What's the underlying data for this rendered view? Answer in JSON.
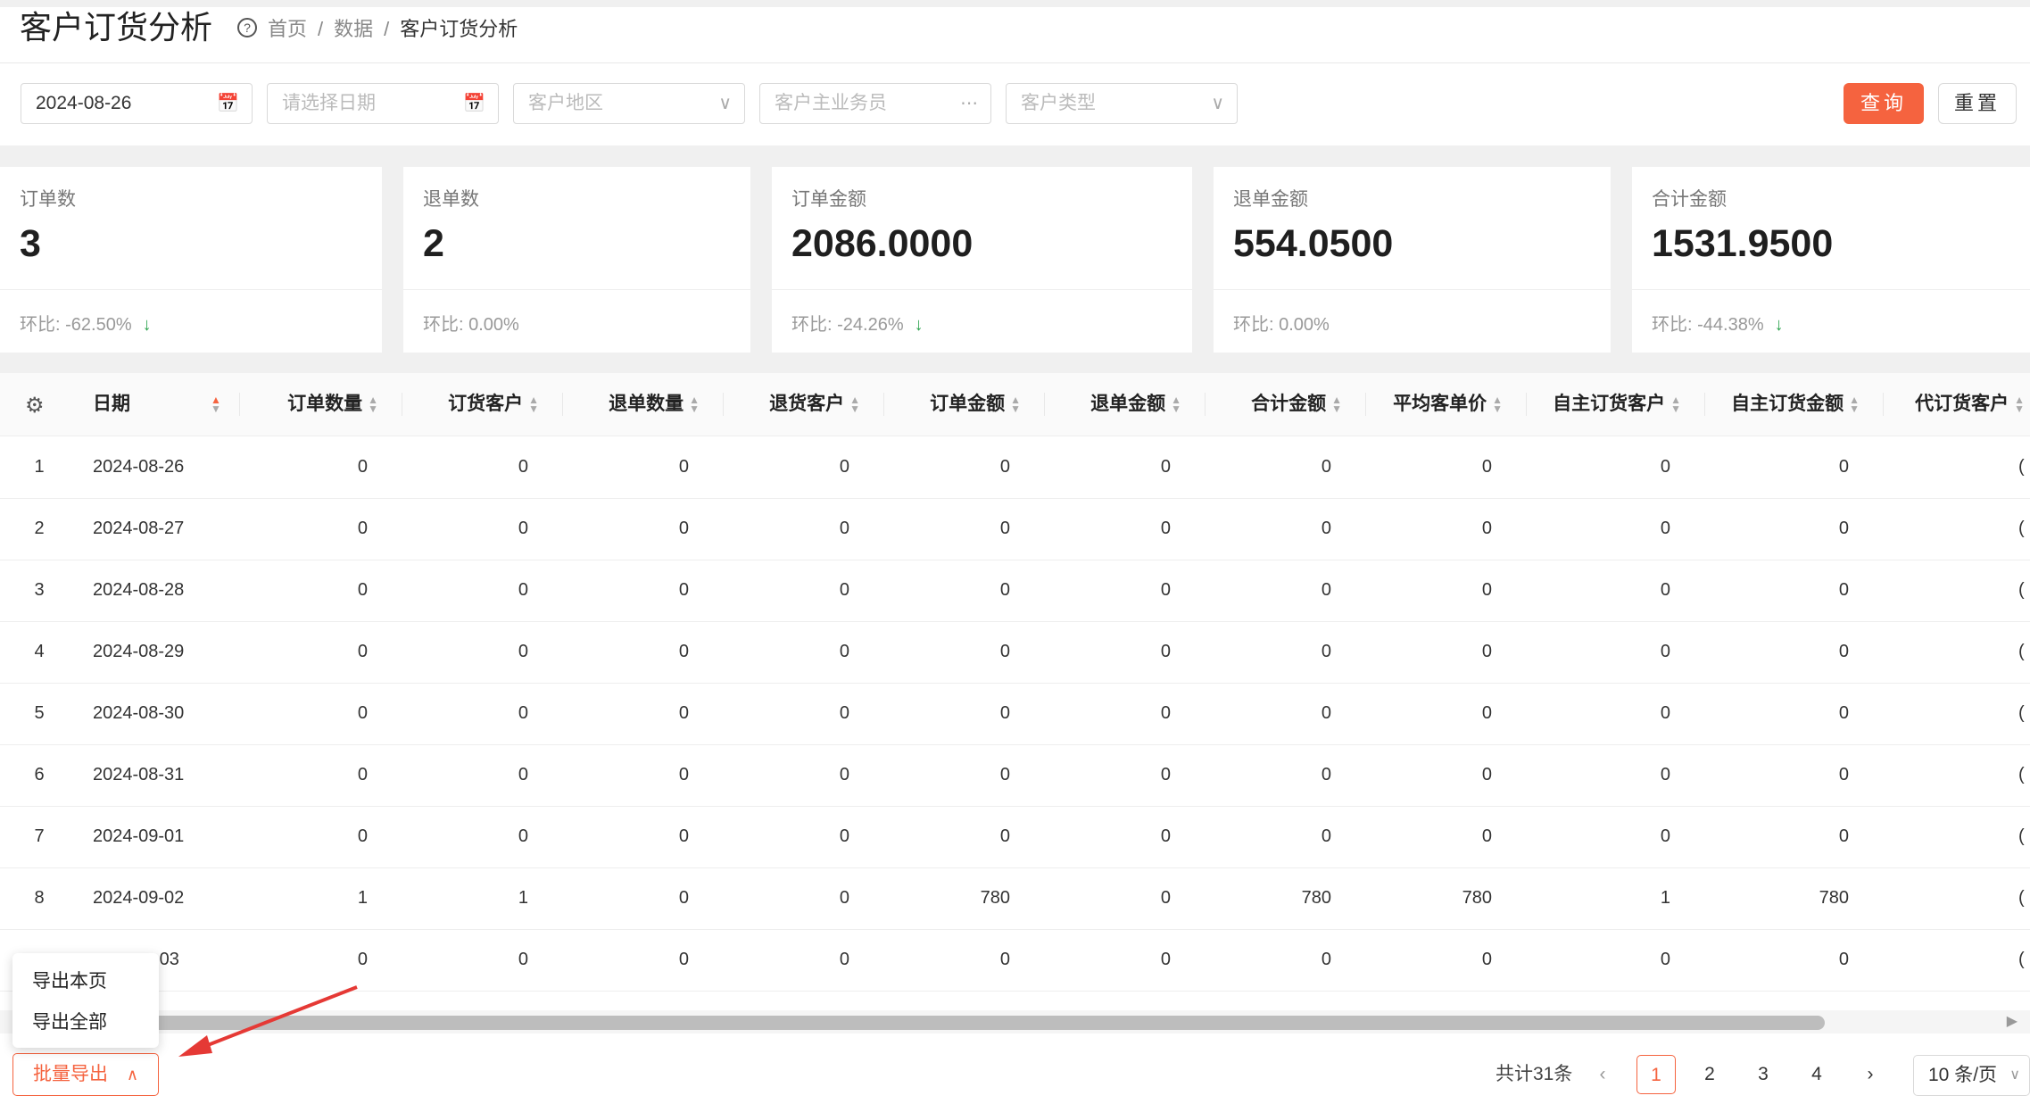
{
  "header": {
    "title": "客户订货分析",
    "breadcrumbs": [
      "首页",
      "数据",
      "客户订货分析"
    ]
  },
  "filters": {
    "start_date": "2024-08-26",
    "end_date_placeholder": "请选择日期",
    "region_placeholder": "客户地区",
    "salesman_placeholder": "客户主业务员",
    "type_placeholder": "客户类型",
    "query_label": "查询",
    "reset_label": "重置"
  },
  "cards": [
    {
      "label": "订单数",
      "value": "3",
      "ratio_label": "环比:",
      "ratio": "-62.50%",
      "down": true
    },
    {
      "label": "退单数",
      "value": "2",
      "ratio_label": "环比:",
      "ratio": "0.00%",
      "down": false
    },
    {
      "label": "订单金额",
      "value": "2086.0000",
      "ratio_label": "环比:",
      "ratio": "-24.26%",
      "down": true
    },
    {
      "label": "退单金额",
      "value": "554.0500",
      "ratio_label": "环比:",
      "ratio": "0.00%",
      "down": false
    },
    {
      "label": "合计金额",
      "value": "1531.9500",
      "ratio_label": "环比:",
      "ratio": "-44.38%",
      "down": true
    }
  ],
  "table": {
    "columns": [
      "日期",
      "订单数量",
      "订货客户",
      "退单数量",
      "退货客户",
      "订单金额",
      "退单金额",
      "合计金额",
      "平均客单价",
      "自主订货客户",
      "自主订货金额",
      "代订货客户"
    ],
    "rows": [
      {
        "idx": "1",
        "date": "2024-08-26",
        "vals": [
          "0",
          "0",
          "0",
          "0",
          "0",
          "0",
          "0",
          "0",
          "0",
          "0"
        ]
      },
      {
        "idx": "2",
        "date": "2024-08-27",
        "vals": [
          "0",
          "0",
          "0",
          "0",
          "0",
          "0",
          "0",
          "0",
          "0",
          "0"
        ]
      },
      {
        "idx": "3",
        "date": "2024-08-28",
        "vals": [
          "0",
          "0",
          "0",
          "0",
          "0",
          "0",
          "0",
          "0",
          "0",
          "0"
        ]
      },
      {
        "idx": "4",
        "date": "2024-08-29",
        "vals": [
          "0",
          "0",
          "0",
          "0",
          "0",
          "0",
          "0",
          "0",
          "0",
          "0"
        ]
      },
      {
        "idx": "5",
        "date": "2024-08-30",
        "vals": [
          "0",
          "0",
          "0",
          "0",
          "0",
          "0",
          "0",
          "0",
          "0",
          "0"
        ]
      },
      {
        "idx": "6",
        "date": "2024-08-31",
        "vals": [
          "0",
          "0",
          "0",
          "0",
          "0",
          "0",
          "0",
          "0",
          "0",
          "0"
        ]
      },
      {
        "idx": "7",
        "date": "2024-09-01",
        "vals": [
          "0",
          "0",
          "0",
          "0",
          "0",
          "0",
          "0",
          "0",
          "0",
          "0"
        ]
      },
      {
        "idx": "8",
        "date": "2024-09-02",
        "vals": [
          "1",
          "1",
          "0",
          "0",
          "780",
          "0",
          "780",
          "780",
          "1",
          "780"
        ]
      },
      {
        "idx": "",
        "date": "-03",
        "vals": [
          "0",
          "0",
          "0",
          "0",
          "0",
          "0",
          "0",
          "0",
          "0",
          "0"
        ]
      }
    ]
  },
  "export_menu": {
    "button_label": "批量导出",
    "items": [
      "导出本页",
      "导出全部"
    ]
  },
  "pagination": {
    "total": "共计31条",
    "pages": [
      "1",
      "2",
      "3",
      "4"
    ],
    "current": "1",
    "page_size": "10 条/页"
  }
}
